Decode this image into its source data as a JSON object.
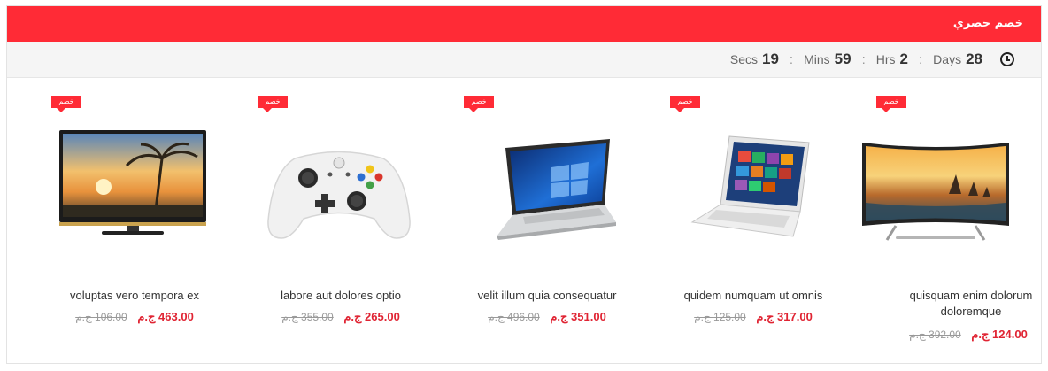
{
  "banner": {
    "title": "خصم حصري"
  },
  "timer": {
    "days_value": "28",
    "days_label": "Days",
    "hours_value": "2",
    "hours_label": "Hrs",
    "mins_value": "59",
    "mins_label": "Mins",
    "secs_value": "19",
    "secs_label": "Secs",
    "separator": ":"
  },
  "products": [
    {
      "badge": "خصم",
      "name": "voluptas vero tempora ex",
      "price": "463.00 ج.م",
      "old_price": "106.00 ج.م"
    },
    {
      "badge": "خصم",
      "name": "labore aut dolores optio",
      "price": "265.00 ج.م",
      "old_price": "355.00 ج.م"
    },
    {
      "badge": "خصم",
      "name": "velit illum quia consequatur",
      "price": "351.00 ج.م",
      "old_price": "496.00 ج.م"
    },
    {
      "badge": "خصم",
      "name": "quidem numquam ut omnis",
      "price": "317.00 ج.م",
      "old_price": "125.00 ج.م"
    },
    {
      "badge": "خصم",
      "name": "quisquam enim dolorum doloremque",
      "price": "124.00 ج.م",
      "old_price": "392.00 ج.م"
    }
  ],
  "colors": {
    "accent": "#ff2b36",
    "price": "#e02433",
    "timer_bg": "#f5f5f5"
  },
  "icons": {
    "timer": "clock-icon"
  }
}
